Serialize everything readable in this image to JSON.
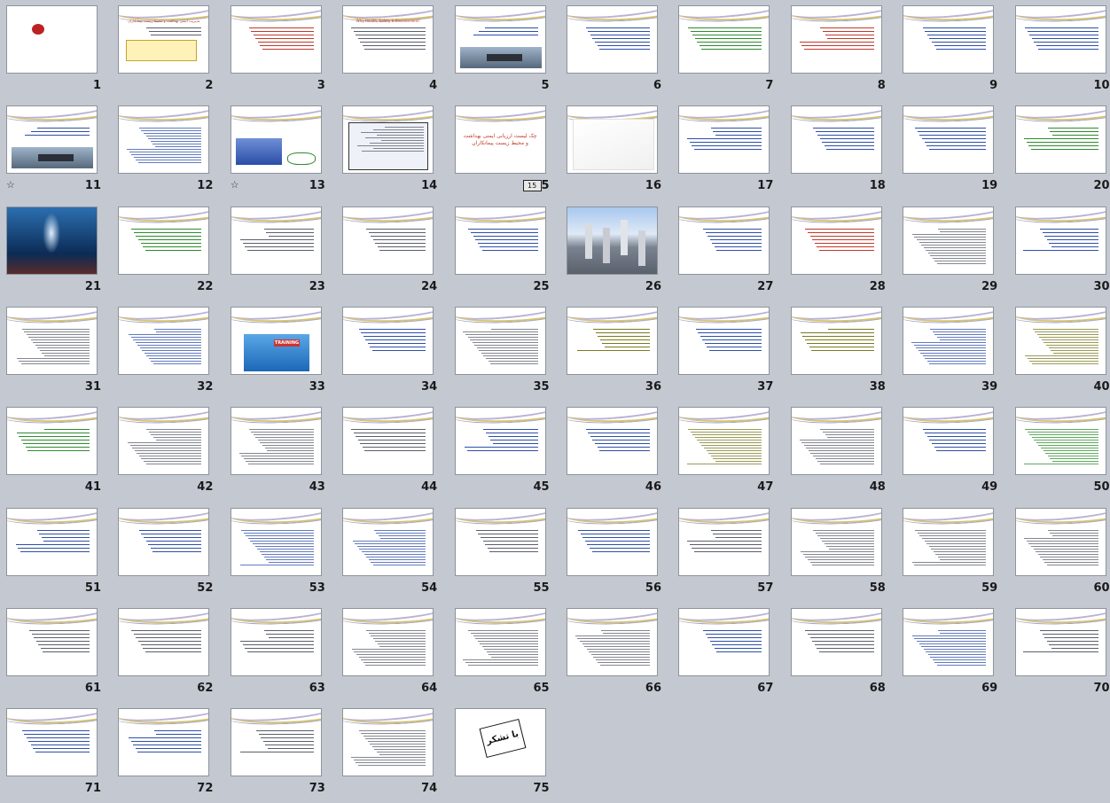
{
  "slides": [
    {
      "n": "1",
      "t": "calli"
    },
    {
      "n": "2",
      "t": "gold",
      "title": "مدیریت ایمنی بهداشت و محیط زیست پیمانکاران"
    },
    {
      "n": "3",
      "t": "text",
      "c": "red"
    },
    {
      "n": "4",
      "t": "text",
      "title": "Why Health, Safety & Environment?"
    },
    {
      "n": "5",
      "t": "ship"
    },
    {
      "n": "6",
      "t": "text",
      "c": "blue"
    },
    {
      "n": "7",
      "t": "text",
      "c": "green"
    },
    {
      "n": "8",
      "t": "text",
      "c": "red"
    },
    {
      "n": "9",
      "t": "text",
      "c": "blue"
    },
    {
      "n": "10",
      "t": "text",
      "c": "blue"
    },
    {
      "n": "11",
      "t": "ship2",
      "star": true
    },
    {
      "n": "12",
      "t": "text",
      "c": "blue",
      "dense": true
    },
    {
      "n": "13",
      "t": "bluephoto",
      "star": true
    },
    {
      "n": "14",
      "t": "frame"
    },
    {
      "n": "15",
      "t": "mid",
      "film": true,
      "text": "چک لیست ارزیابی ایمنی بهداشت و محیط زیست پیمانکاران"
    },
    {
      "n": "16",
      "t": "blank"
    },
    {
      "n": "17",
      "t": "text",
      "c": "blue"
    },
    {
      "n": "18",
      "t": "text",
      "c": "blue"
    },
    {
      "n": "19",
      "t": "text",
      "c": "blue"
    },
    {
      "n": "20",
      "t": "text",
      "c": "green"
    },
    {
      "n": "21",
      "t": "underwater"
    },
    {
      "n": "22",
      "t": "text",
      "c": "green"
    },
    {
      "n": "23",
      "t": "text",
      "c": "gray"
    },
    {
      "n": "24",
      "t": "text",
      "c": "gray"
    },
    {
      "n": "25",
      "t": "text",
      "c": "blue"
    },
    {
      "n": "26",
      "t": "refinery"
    },
    {
      "n": "27",
      "t": "text",
      "c": "blue"
    },
    {
      "n": "28",
      "t": "text",
      "c": "red"
    },
    {
      "n": "29",
      "t": "text",
      "c": "gray",
      "dense": true
    },
    {
      "n": "30",
      "t": "text",
      "c": "blue"
    },
    {
      "n": "31",
      "t": "text",
      "c": "gray",
      "dense": true
    },
    {
      "n": "32",
      "t": "text",
      "c": "blue",
      "dense": true
    },
    {
      "n": "33",
      "t": "training"
    },
    {
      "n": "34",
      "t": "text",
      "c": "blue"
    },
    {
      "n": "35",
      "t": "text",
      "c": "gray",
      "dense": true
    },
    {
      "n": "36",
      "t": "text",
      "c": "olive"
    },
    {
      "n": "37",
      "t": "text",
      "c": "blue"
    },
    {
      "n": "38",
      "t": "text",
      "c": "olive"
    },
    {
      "n": "39",
      "t": "text",
      "c": "blue",
      "dense": true
    },
    {
      "n": "40",
      "t": "text",
      "c": "olive",
      "dense": true
    },
    {
      "n": "41",
      "t": "text",
      "c": "green"
    },
    {
      "n": "42",
      "t": "text",
      "c": "gray",
      "dense": true
    },
    {
      "n": "43",
      "t": "text",
      "c": "gray",
      "dense": true
    },
    {
      "n": "44",
      "t": "text",
      "c": "gray"
    },
    {
      "n": "45",
      "t": "text",
      "c": "blue"
    },
    {
      "n": "46",
      "t": "text",
      "c": "blue"
    },
    {
      "n": "47",
      "t": "text",
      "c": "olive",
      "dense": true
    },
    {
      "n": "48",
      "t": "text",
      "c": "gray",
      "dense": true
    },
    {
      "n": "49",
      "t": "text",
      "c": "blue"
    },
    {
      "n": "50",
      "t": "text",
      "c": "green",
      "dense": true
    },
    {
      "n": "51",
      "t": "text",
      "c": "blue"
    },
    {
      "n": "52",
      "t": "text",
      "c": "blue"
    },
    {
      "n": "53",
      "t": "text",
      "c": "blue",
      "dense": true
    },
    {
      "n": "54",
      "t": "text",
      "c": "blue",
      "dense": true
    },
    {
      "n": "55",
      "t": "text",
      "c": "gray"
    },
    {
      "n": "56",
      "t": "text",
      "c": "blue"
    },
    {
      "n": "57",
      "t": "text",
      "c": "gray"
    },
    {
      "n": "58",
      "t": "text",
      "c": "gray",
      "dense": true
    },
    {
      "n": "59",
      "t": "text",
      "c": "gray",
      "dense": true
    },
    {
      "n": "60",
      "t": "text",
      "c": "gray",
      "dense": true
    },
    {
      "n": "61",
      "t": "text",
      "c": "gray"
    },
    {
      "n": "62",
      "t": "text",
      "c": "gray"
    },
    {
      "n": "63",
      "t": "text",
      "c": "gray"
    },
    {
      "n": "64",
      "t": "text",
      "c": "gray",
      "dense": true
    },
    {
      "n": "65",
      "t": "text",
      "c": "gray",
      "dense": true
    },
    {
      "n": "66",
      "t": "text",
      "c": "gray",
      "dense": true
    },
    {
      "n": "67",
      "t": "text",
      "c": "blue"
    },
    {
      "n": "68",
      "t": "text",
      "c": "gray"
    },
    {
      "n": "69",
      "t": "text",
      "c": "blue",
      "dense": true
    },
    {
      "n": "70",
      "t": "text",
      "c": "gray"
    },
    {
      "n": "71",
      "t": "text",
      "c": "blue"
    },
    {
      "n": "72",
      "t": "text",
      "c": "blue"
    },
    {
      "n": "73",
      "t": "text",
      "c": "gray"
    },
    {
      "n": "74",
      "t": "text",
      "c": "gray",
      "dense": true
    },
    {
      "n": "75",
      "t": "thanks",
      "text": "با تشکر"
    }
  ],
  "colors": {
    "accent": "#4a78c8",
    "background": "#c4c8d1"
  }
}
